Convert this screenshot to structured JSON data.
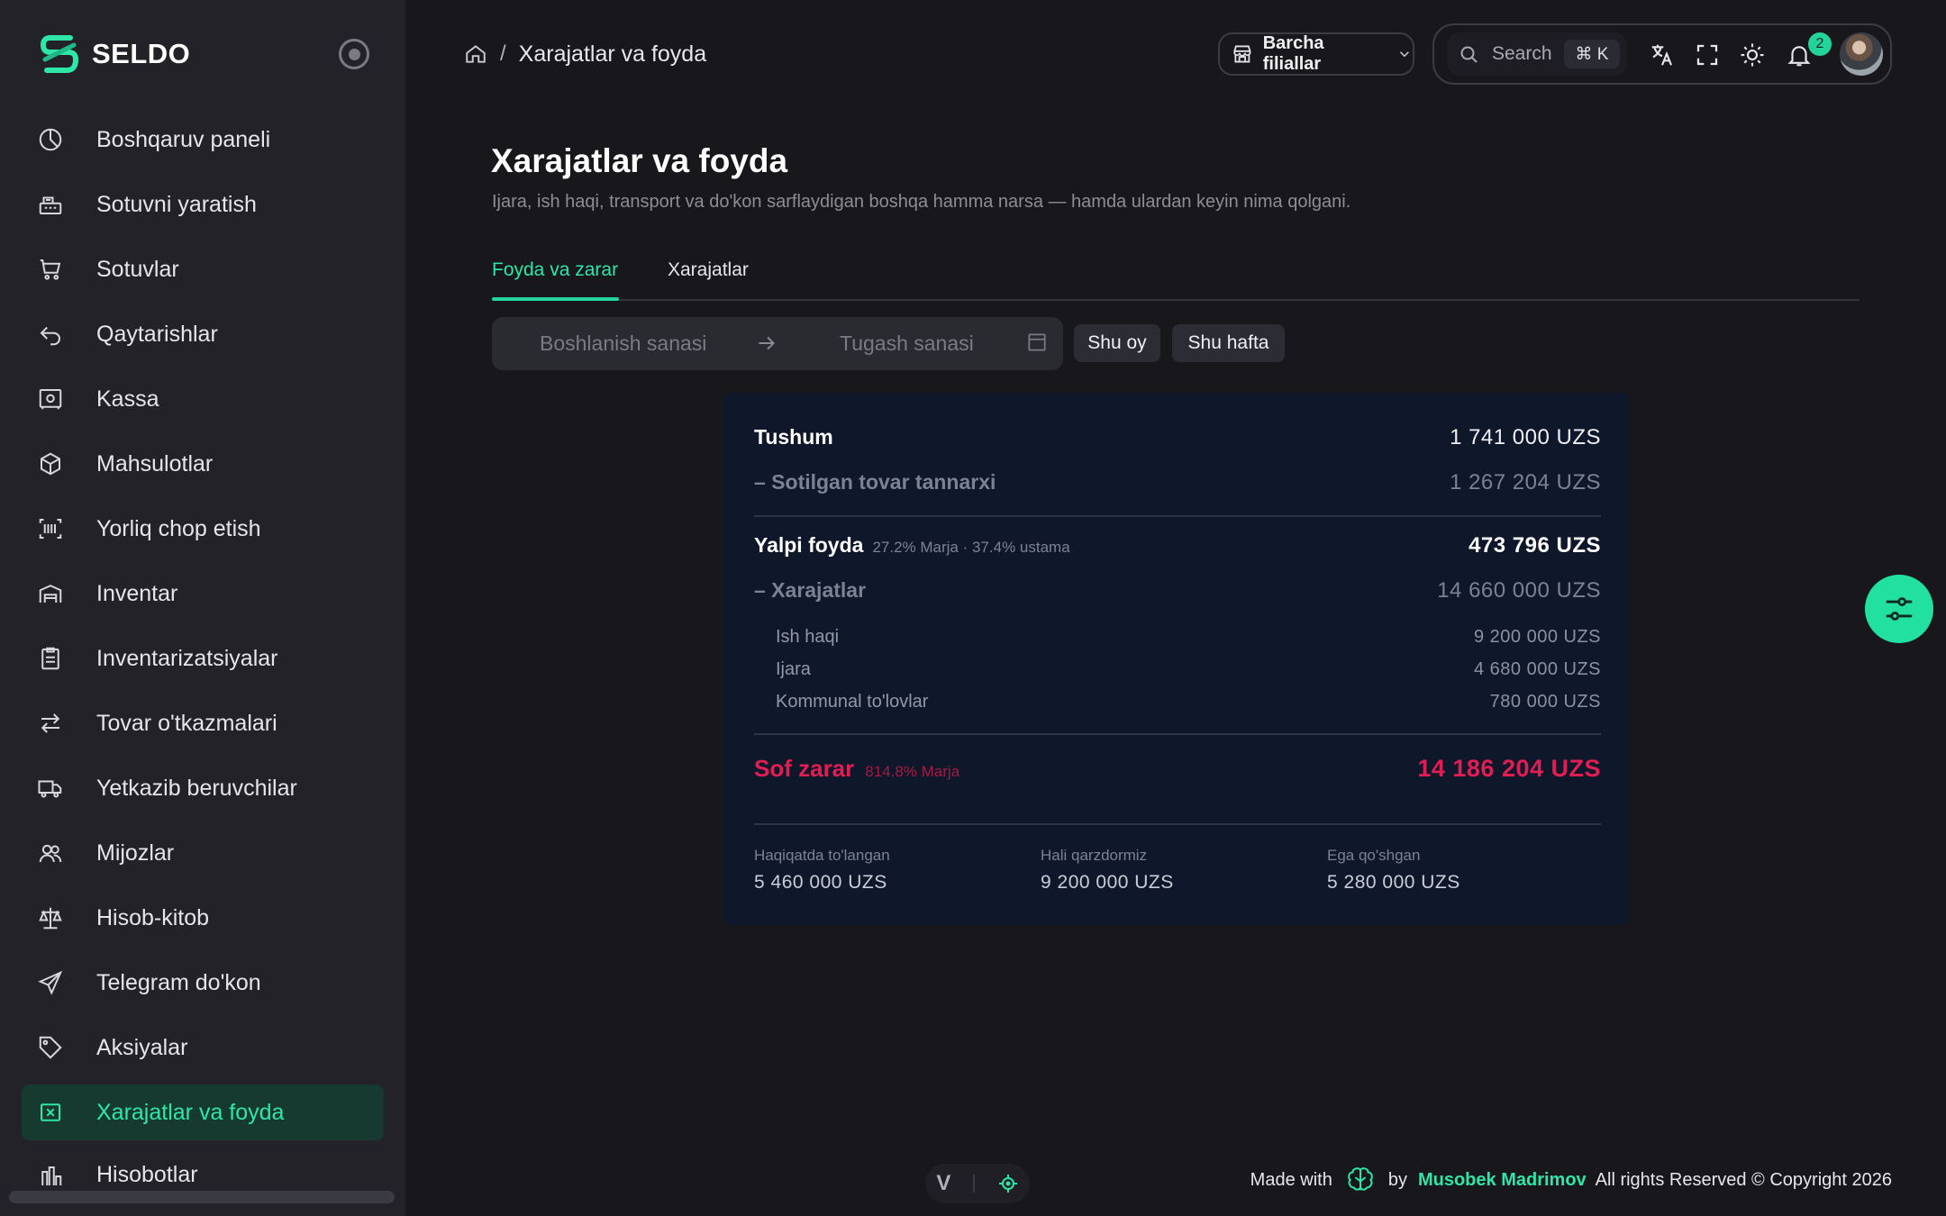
{
  "app": {
    "name": "SELDO"
  },
  "sidebar": {
    "items": [
      {
        "label": "Boshqaruv paneli",
        "icon": "pie-chart-icon"
      },
      {
        "label": "Sotuvni yaratish",
        "icon": "cash-register-icon"
      },
      {
        "label": "Sotuvlar",
        "icon": "cart-icon"
      },
      {
        "label": "Qaytarishlar",
        "icon": "return-arrow-icon"
      },
      {
        "label": "Kassa",
        "icon": "safe-icon"
      },
      {
        "label": "Mahsulotlar",
        "icon": "box-icon"
      },
      {
        "label": "Yorliq chop etish",
        "icon": "barcode-icon"
      },
      {
        "label": "Inventar",
        "icon": "warehouse-icon"
      },
      {
        "label": "Inventarizatsiyalar",
        "icon": "clipboard-icon"
      },
      {
        "label": "Tovar o'tkazmalari",
        "icon": "transfer-icon"
      },
      {
        "label": "Yetkazib beruvchilar",
        "icon": "truck-icon"
      },
      {
        "label": "Mijozlar",
        "icon": "users-icon"
      },
      {
        "label": "Hisob-kitob",
        "icon": "scale-icon"
      },
      {
        "label": "Telegram do'kon",
        "icon": "send-icon"
      },
      {
        "label": "Aksiyalar",
        "icon": "tag-icon"
      },
      {
        "label": "Xarajatlar va foyda",
        "icon": "receipt-x-icon",
        "active": true
      },
      {
        "label": "Hisobotlar",
        "icon": "report-icon"
      }
    ]
  },
  "header": {
    "breadcrumb_current": "Xarajatlar va foyda",
    "breadcrumb_sep": "/",
    "branch_select": "Barcha filiallar",
    "search_placeholder": "Search",
    "search_shortcut": "⌘ K",
    "notification_count": "2"
  },
  "page": {
    "title": "Xarajatlar va foyda",
    "subtitle": "Ijara, ish haqi, transport va do'kon sarflaydigan boshqa hamma narsa — hamda ulardan keyin nima qolgani.",
    "tabs": [
      {
        "label": "Foyda va zarar",
        "active": true
      },
      {
        "label": "Xarajatlar",
        "active": false
      }
    ],
    "filters": {
      "start_placeholder": "Boshlanish sanasi",
      "end_placeholder": "Tugash sanasi",
      "chip_month": "Shu oy",
      "chip_week": "Shu hafta"
    }
  },
  "report": {
    "revenue_label": "Tushum",
    "revenue_value": "1 741 000 UZS",
    "cogs_label": "– Sotilgan tovar tannarxi",
    "cogs_value": "1 267 204 UZS",
    "gross_label": "Yalpi foyda",
    "gross_note": "27.2% Marja · 37.4% ustama",
    "gross_value": "473 796 UZS",
    "expenses_label": "– Xarajatlar",
    "expenses_value": "14 660 000 UZS",
    "expense_items": [
      {
        "label": "Ish haqi",
        "value": "9 200 000 UZS"
      },
      {
        "label": "Ijara",
        "value": "4 680 000 UZS"
      },
      {
        "label": "Kommunal to'lovlar",
        "value": "780 000 UZS"
      }
    ],
    "net_label": "Sof zarar",
    "net_note": "814.8% Marja",
    "net_value": "14 186 204 UZS",
    "stats": [
      {
        "label": "Haqiqatda to'langan",
        "value": "5 460 000 UZS"
      },
      {
        "label": "Hali qarzdormiz",
        "value": "9 200 000 UZS"
      },
      {
        "label": "Ega qo'shgan",
        "value": "5 280 000 UZS"
      }
    ]
  },
  "footer": {
    "made_with": "Made with",
    "by": "by",
    "author": "Musobek Madrimov",
    "rights": "All rights Reserved © Copyright 2026",
    "dev_letter": "V"
  },
  "colors": {
    "accent": "#22d39a",
    "loss": "#e01e53",
    "card_bg": "#0f172a",
    "sidebar_bg": "#222228"
  }
}
